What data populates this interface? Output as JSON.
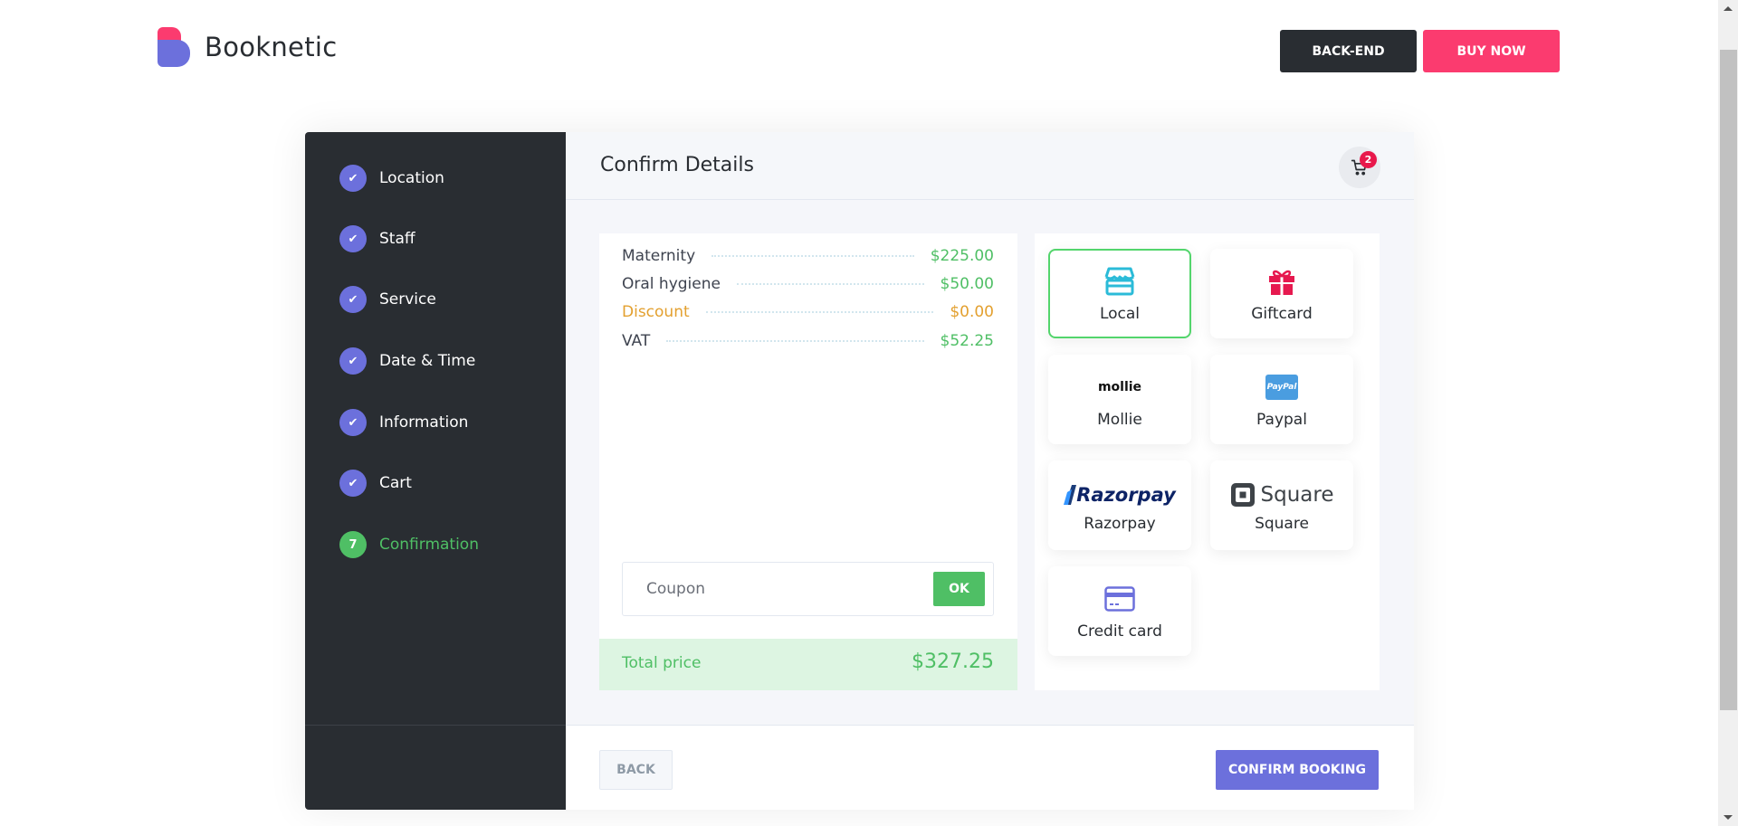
{
  "brand": {
    "name": "Booknetic"
  },
  "header_buttons": {
    "backend": "BACK-END",
    "buy_now": "BUY NOW"
  },
  "steps": [
    {
      "label": "Location",
      "status": "done",
      "icon": "check-icon"
    },
    {
      "label": "Staff",
      "status": "done",
      "icon": "check-icon"
    },
    {
      "label": "Service",
      "status": "done",
      "icon": "check-icon"
    },
    {
      "label": "Date & Time",
      "status": "done",
      "icon": "check-icon"
    },
    {
      "label": "Information",
      "status": "done",
      "icon": "check-icon"
    },
    {
      "label": "Cart",
      "status": "done",
      "icon": "check-icon"
    },
    {
      "label": "Confirmation",
      "status": "active",
      "number": "7"
    }
  ],
  "main": {
    "title": "Confirm Details",
    "cart_count": "2",
    "price_rows": [
      {
        "name": "Maternity",
        "value": "$225.00",
        "type": "item"
      },
      {
        "name": "Oral hygiene",
        "value": "$50.00",
        "type": "item"
      },
      {
        "name": "Discount",
        "value": "$0.00",
        "type": "discount"
      },
      {
        "name": "VAT",
        "value": "$52.25",
        "type": "item"
      }
    ],
    "coupon": {
      "placeholder": "Coupon",
      "value": "",
      "button": "OK"
    },
    "total": {
      "label": "Total price",
      "value": "$327.25"
    },
    "payment_methods": [
      {
        "label": "Local",
        "icon": "store-icon",
        "selected": true
      },
      {
        "label": "Giftcard",
        "icon": "gift-icon",
        "selected": false
      },
      {
        "label": "Mollie",
        "icon": "mollie-logo",
        "logo_text": "mollie",
        "selected": false
      },
      {
        "label": "Paypal",
        "icon": "paypal-logo",
        "logo_text": "PayPal",
        "selected": false
      },
      {
        "label": "Razorpay",
        "icon": "razorpay-logo",
        "logo_text": "Razorpay",
        "selected": false
      },
      {
        "label": "Square",
        "icon": "square-logo",
        "logo_text": "Square",
        "selected": false
      },
      {
        "label": "Credit card",
        "icon": "credit-card-icon",
        "selected": false
      }
    ],
    "footer": {
      "back": "BACK",
      "confirm": "CONFIRM BOOKING"
    }
  },
  "colors": {
    "accent": "#6c70dc",
    "success": "#4fbf65",
    "warning": "#e3a02f",
    "brand_pink": "#fb3b6f",
    "dark": "#292d32"
  }
}
